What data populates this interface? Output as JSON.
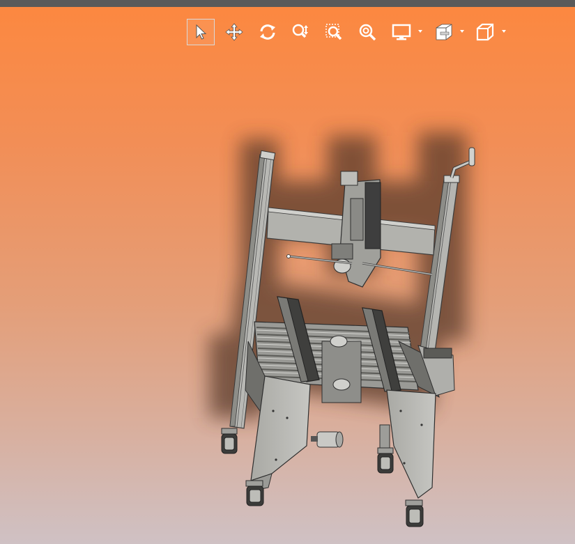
{
  "toolbar": {
    "buttons": [
      {
        "name": "select-tool-button",
        "icon": "cursor-arrow-icon",
        "active": true
      },
      {
        "name": "pan-tool-button",
        "icon": "move-arrows-icon",
        "active": false
      },
      {
        "name": "rotate-tool-button",
        "icon": "rotate-arrows-icon",
        "active": false
      },
      {
        "name": "zoom-tool-button",
        "icon": "zoom-arrows-icon",
        "active": false
      },
      {
        "name": "zoom-window-button",
        "icon": "zoom-window-icon",
        "active": false
      },
      {
        "name": "zoom-fit-button",
        "icon": "zoom-fit-icon",
        "active": false
      },
      {
        "name": "display-mode-dropdown",
        "icon": "monitor-icon",
        "active": false
      },
      {
        "name": "section-view-dropdown",
        "icon": "section-cube-icon",
        "active": false
      },
      {
        "name": "standard-view-dropdown",
        "icon": "view-cube-icon",
        "active": false
      }
    ]
  },
  "viewport": {
    "background_top": "#fc8840",
    "background_bottom": "#cfc1c4",
    "model": "case-taping-machine-3d-model"
  }
}
